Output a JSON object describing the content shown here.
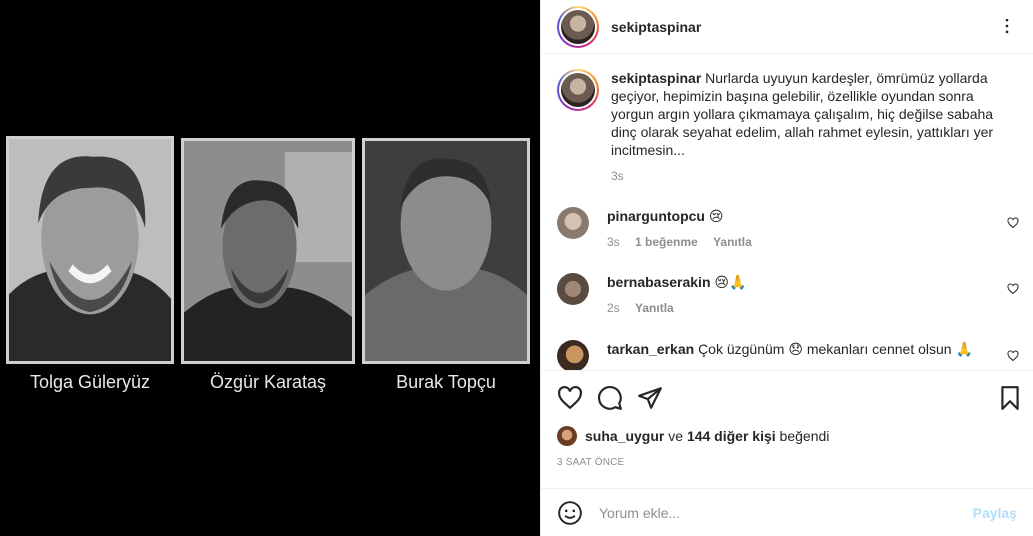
{
  "media": {
    "captions": [
      "Tolga Güleryüz",
      "Özgür Karataş",
      "Burak Topçu"
    ]
  },
  "header": {
    "username": "sekiptaspinar"
  },
  "caption": {
    "username": "sekiptaspinar",
    "text": "Nurlarda uyuyun kardeşler, ömrümüz yollarda geçiyor, hepimizin başına gelebilir, özellikle oyundan sonra yorgun argın yollara çıkmamaya çalışalım, hiç değilse sabaha dinç olarak seyahat edelim, allah rahmet eylesin, yattıkları yer incitmesin...",
    "time": "3s"
  },
  "comments": [
    {
      "username": "pinarguntopcu",
      "text": "😢",
      "time": "3s",
      "likes": "1 beğenme",
      "reply": "Yanıtla"
    },
    {
      "username": "bernabaserakin",
      "text": "😢🙏",
      "time": "2s",
      "reply": "Yanıtla"
    },
    {
      "username": "tarkan_erkan",
      "text": "Çok üzgünüm 😞 mekanları cennet olsun 🙏"
    }
  ],
  "likes": {
    "user": "suha_uygur",
    "connector": "ve",
    "others": "144 diğer kişi",
    "suffix": "beğendi"
  },
  "timestamp": "3 SAAT ÖNCE",
  "add_comment": {
    "placeholder": "Yorum ekle...",
    "share_label": "Paylaş"
  }
}
